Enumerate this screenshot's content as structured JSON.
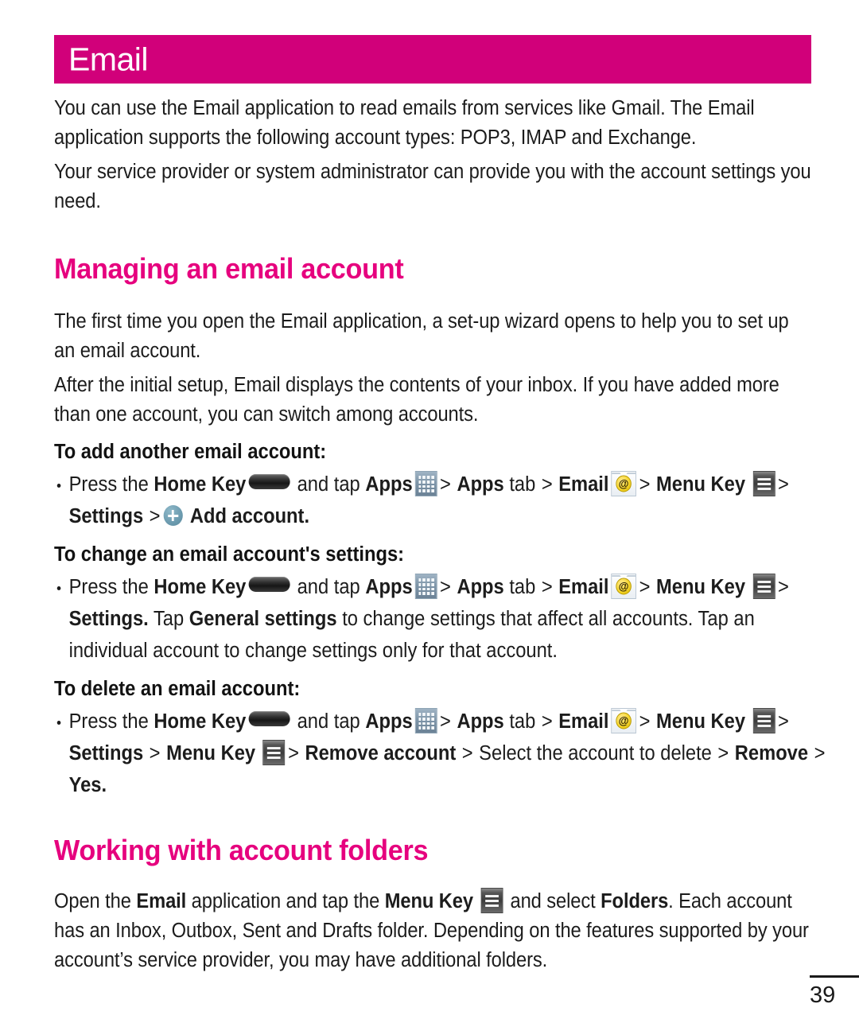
{
  "banner": {
    "title": "Email",
    "bg_color": "#D1007A",
    "text_color": "#FFFFFF"
  },
  "intro": {
    "paragraph_1": "You can use the Email application to read emails from services like Gmail. The Email application supports the following account types: POP3, IMAP and Exchange.",
    "paragraph_2": "Your service provider or system administrator can provide you with the account settings you need."
  },
  "sections": [
    {
      "heading": "Managing an email account",
      "heading_color": "#E6007E",
      "paragraph_1": "The first time you open the Email application, a set-up wizard opens to help you to set up an email account.",
      "paragraph_2": "After the initial setup, Email displays the contents of your inbox. If you have added more than one account, you can switch among accounts."
    },
    {
      "heading": "Working with account folders",
      "heading_color": "#E6007E",
      "paragraph_1": "Open the Email application and tap the Menu Key and select Folders. Each account has an Inbox, Outbox, Sent and Drafts folder. Depending on the features supported by your account’s service provider, you may have additional folders."
    }
  ],
  "procedures": [
    {
      "subhead": "To add another email account:",
      "steps_text": {
        "press_the": "Press the",
        "home_key": "Home Key",
        "and_tap": "and tap",
        "apps": "Apps",
        "apps_tab": "Apps",
        "tab": "tab",
        "email": "Email",
        "menu_key": "Menu Key",
        "settings": "Settings",
        "add_account": "Add account.",
        "arrow": ">"
      }
    },
    {
      "subhead": "To change an email account's settings:",
      "steps_text": {
        "press_the": "Press the",
        "home_key": "Home Key",
        "and_tap": "and tap",
        "apps": "Apps",
        "apps_tab": "Apps",
        "tab": "tab",
        "email": "Email",
        "menu_key": "Menu Key",
        "settings_period": "Settings.",
        "tap": "Tap",
        "general_settings": "General settings",
        "tail": "to change settings that affect all accounts. Tap an individual account to change settings only for that account.",
        "arrow": ">"
      }
    },
    {
      "subhead": "To delete an email account:",
      "steps_text": {
        "press_the": "Press the",
        "home_key": "Home Key",
        "and_tap": "and tap",
        "apps": "Apps",
        "apps_tab": "Apps",
        "tab": "tab",
        "email": "Email",
        "menu_key": "Menu Key",
        "settings": "Settings",
        "menu_key_2": "Menu Key",
        "remove_account": "Remove account",
        "select_account": "Select the account to delete",
        "remove": "Remove",
        "yes": "Yes.",
        "arrow": ">"
      }
    }
  ],
  "folders_paragraph": {
    "open_the": "Open the",
    "email": "Email",
    "application_and_tap_the": "application and tap the",
    "menu_key": "Menu Key",
    "and_select": "and select",
    "folders": "Folders",
    "tail": ". Each account has an Inbox, Outbox, Sent and Drafts folder. Depending on the features supported by your account’s service provider, you may have additional folders."
  },
  "icons": {
    "home_key": "home-key-icon",
    "apps": "apps-grid-icon",
    "email": "email-envelope-icon",
    "menu_key": "menu-key-icon",
    "add": "add-plus-icon"
  },
  "footer": {
    "page_number": "39"
  }
}
